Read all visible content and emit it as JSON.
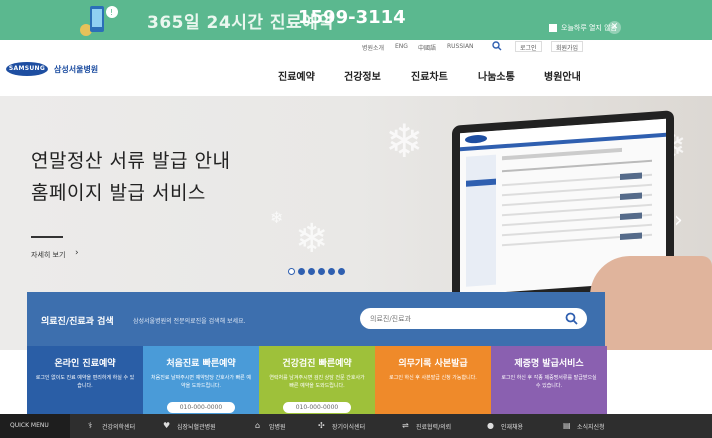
{
  "banner": {
    "text": "365일 24시간 진료예약",
    "phone": "1599-3114",
    "hide_today": "오늘하루 열지 않음",
    "close_glyph": "✕"
  },
  "header": {
    "logo_mark": "SAMSUNG",
    "logo_text": "삼성서울병원",
    "util_links": [
      "병원소개",
      "ENG",
      "中國語",
      "RUSSIAN"
    ],
    "login": "로그인",
    "join": "회원가입",
    "gnb": [
      "진료예약",
      "건강정보",
      "진료차트",
      "나눔소통",
      "병원안내"
    ]
  },
  "hero": {
    "title_line1": "연말정산 서류 발급 안내",
    "title_line2": "홈페이지 발급 서비스",
    "more": "자세히 보기",
    "more_chevron": "›",
    "next_arrow": "›",
    "slide_count": 6,
    "active_slide": 1
  },
  "search": {
    "title": "의료진/진료과 검색",
    "description": "삼성서울병원의 전문의료진을 검색해 보세요.",
    "placeholder": "의료진/진료과"
  },
  "cards": [
    {
      "title": "온라인 진료예약",
      "desc": "로그인 없이도 진료 예약을 편리하게 하실 수 있습니다.",
      "phone": "",
      "color": "#2a5ea6"
    },
    {
      "title": "처음진료 빠른예약",
      "desc": "처음진료 날짜주시면 예약담당 간호사가 빠른 예약을 도와드립니다.",
      "phone": "010-000-0000",
      "color": "#4a9bd8"
    },
    {
      "title": "건강검진 빠른예약",
      "desc": "연락처를 남겨주시면 검진 상담 전문 간호사가 빠른 예약을 도와드립니다.",
      "phone": "010-000-0000",
      "color": "#9ec13a"
    },
    {
      "title": "의무기록 사본발급",
      "desc": "로그인 하신 후 사본발급 신청 가능합니다.",
      "phone": "",
      "color": "#ef8a2a"
    },
    {
      "title": "제증명 발급서비스",
      "desc": "로그인 하신 후 각종 제증명서류를 발급받으실 수 있습니다.",
      "phone": "",
      "color": "#8a60b0"
    }
  ],
  "quick_menu": {
    "label": "QUICK MENU",
    "items": [
      "건강의학센터",
      "심장뇌혈관병원",
      "암병원",
      "장기이식센터",
      "진료협력/의뢰",
      "인재채용",
      "소식지신청"
    ]
  }
}
